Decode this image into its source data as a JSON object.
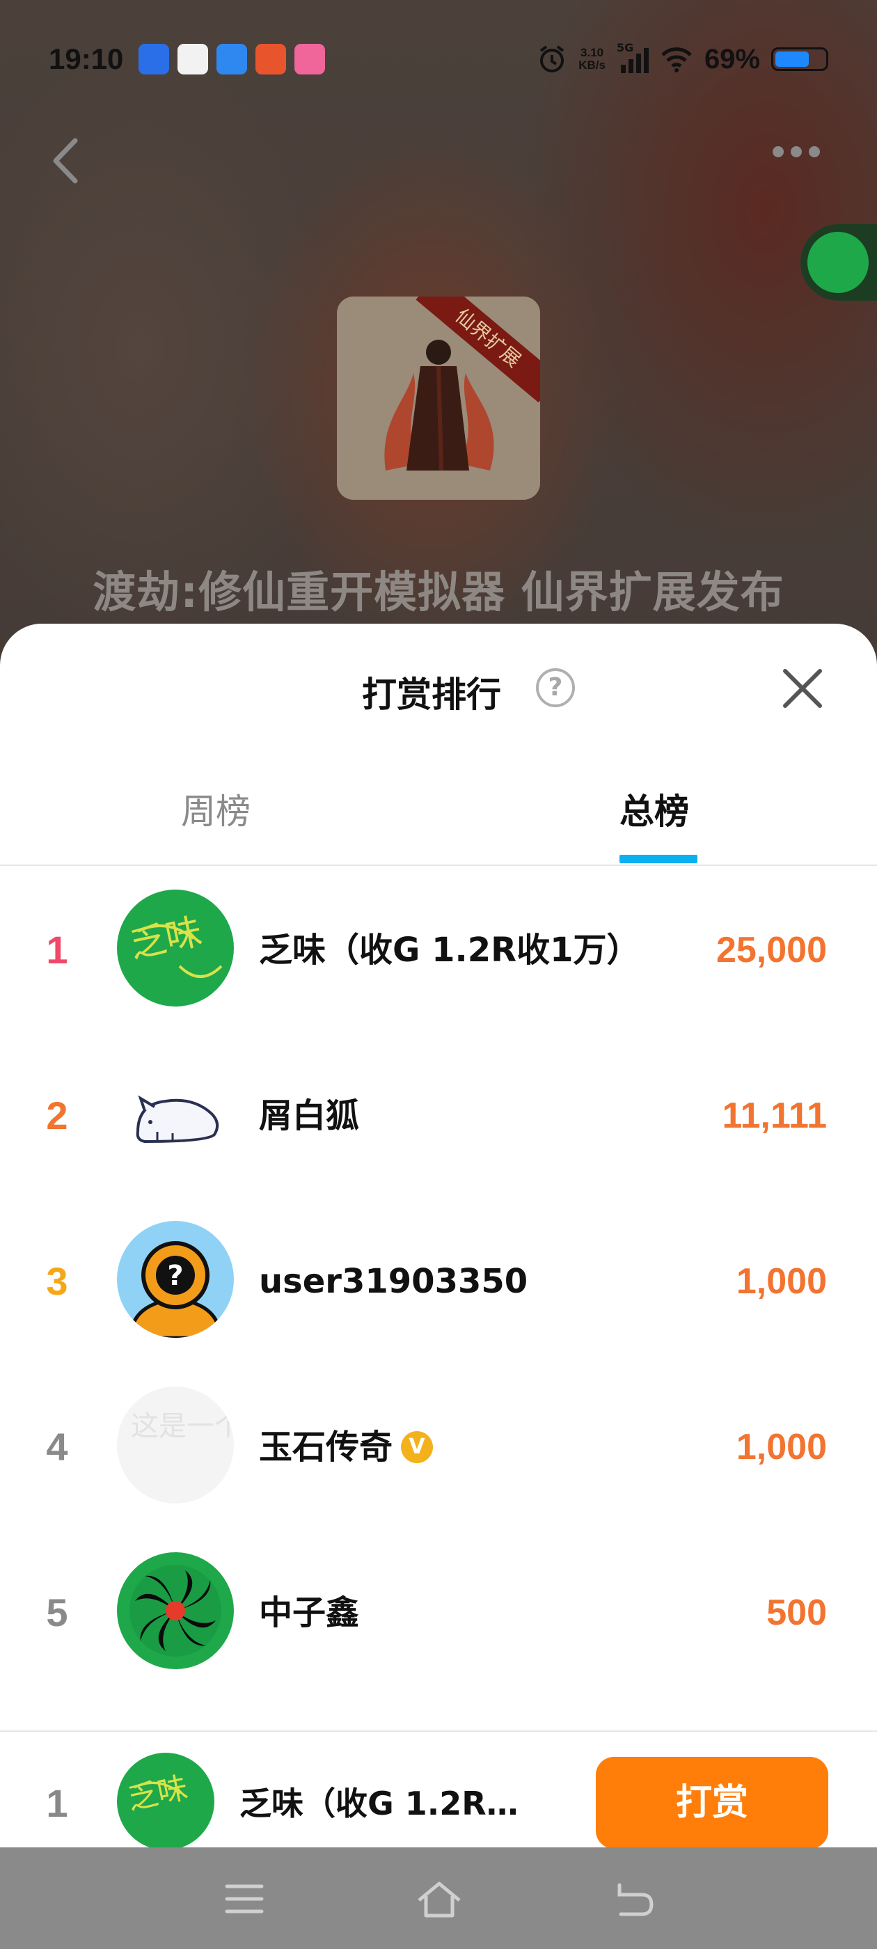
{
  "status_bar": {
    "time": "19:10",
    "net_speed_value": "3.10",
    "net_speed_unit": "KB/s",
    "signal_label": "5G",
    "battery_percent": "69%",
    "battery_level": 0.69
  },
  "background": {
    "game_title": "渡劫:修仙重开模拟器 仙界扩展发布",
    "cover_banner_text": "仙界扩展"
  },
  "sheet": {
    "title": "打赏排行",
    "help_symbol": "?",
    "tabs": [
      {
        "label": "周榜",
        "active": false
      },
      {
        "label": "总榜",
        "active": true
      }
    ]
  },
  "rankings": [
    {
      "rank": "1",
      "name": "乏味（收G 1.2R收1万）",
      "amount": "25,000",
      "rank_color": "#f04a6a",
      "verified": false
    },
    {
      "rank": "2",
      "name": "屑白狐",
      "amount": "11,111",
      "rank_color": "#f27430",
      "verified": false
    },
    {
      "rank": "3",
      "name": "user31903350",
      "amount": "1,000",
      "rank_color": "#f5a716",
      "verified": false
    },
    {
      "rank": "4",
      "name": "玉石传奇",
      "amount": "1,000",
      "rank_color": "#8a8a8a",
      "verified": true,
      "verified_symbol": "V"
    },
    {
      "rank": "5",
      "name": "中子鑫",
      "amount": "500",
      "rank_color": "#8a8a8a",
      "verified": false
    }
  ],
  "avatars": {
    "rank1_text": "乏味",
    "rank4_text": "这是一个柑橘"
  },
  "footer": {
    "my_rank": "1",
    "my_name": "乏味（收G 1.2R…",
    "reward_button_label": "打赏"
  },
  "colors": {
    "accent_orange": "#ff7e0a",
    "amount_orange": "#f27430",
    "tab_indicator": "#0bb0f0"
  }
}
